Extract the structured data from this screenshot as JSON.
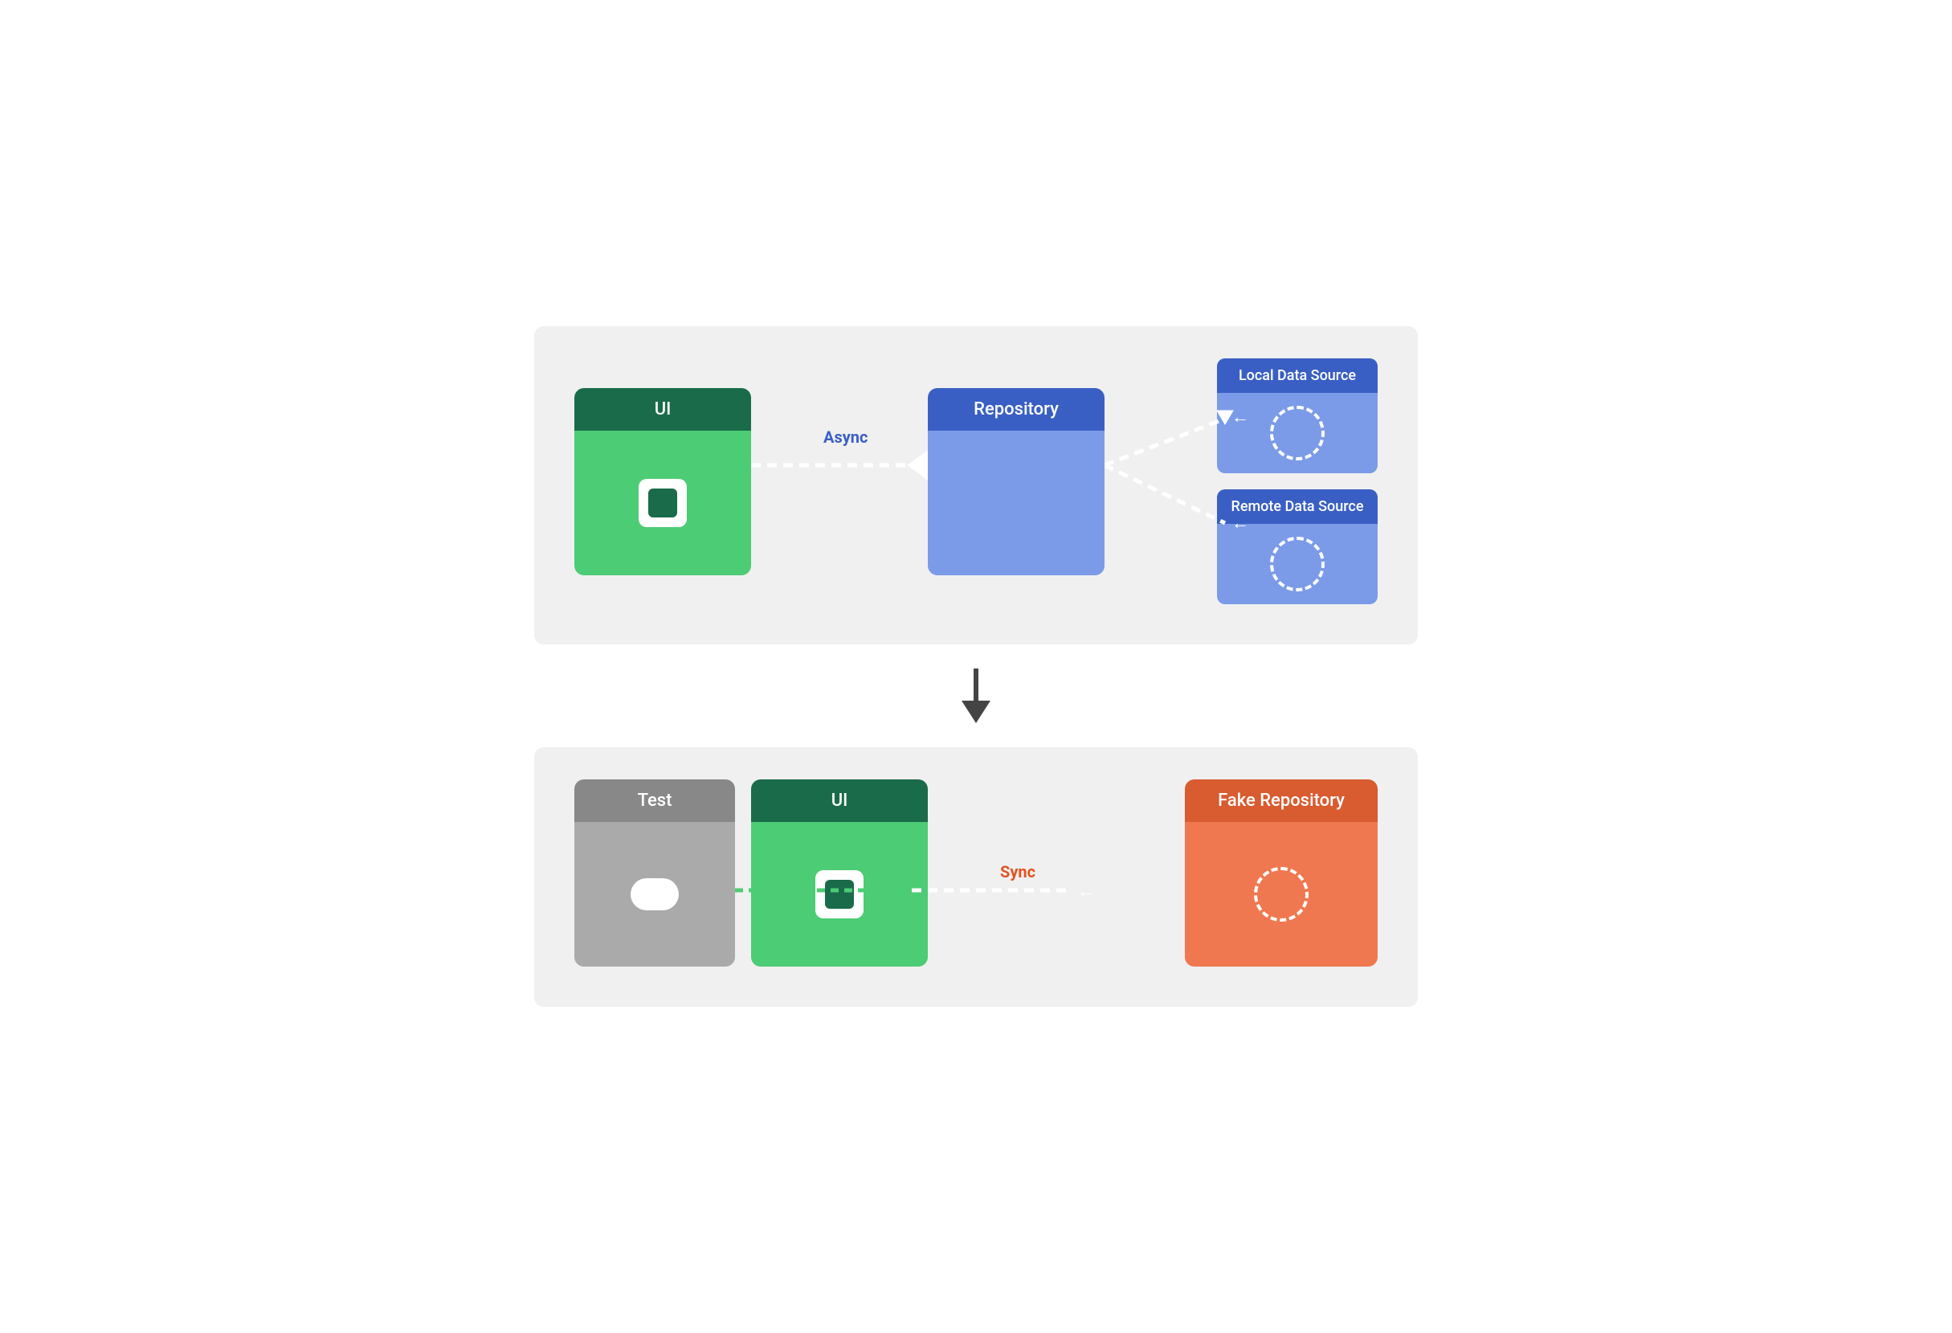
{
  "top_diagram": {
    "ui_label": "UI",
    "repo_label": "Repository",
    "local_source_label": "Local Data Source",
    "remote_source_label": "Remote Data Source",
    "async_label": "Async"
  },
  "bottom_diagram": {
    "test_label": "Test",
    "ui_label": "UI",
    "fake_repo_label": "Fake Repository",
    "sync_label": "Sync"
  },
  "arrow_down": "↓"
}
